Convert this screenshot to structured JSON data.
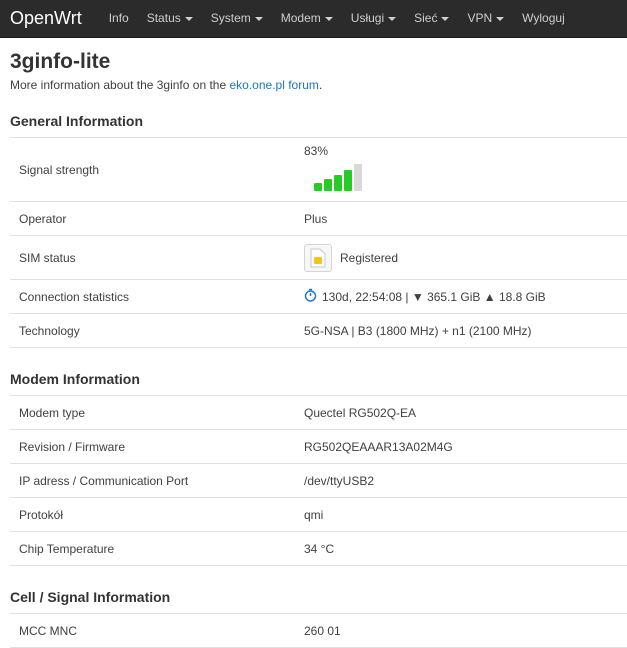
{
  "navbar": {
    "brand": "OpenWrt",
    "items": [
      {
        "label": "Info",
        "dropdown": false
      },
      {
        "label": "Status",
        "dropdown": true
      },
      {
        "label": "System",
        "dropdown": true
      },
      {
        "label": "Modem",
        "dropdown": true
      },
      {
        "label": "Usługi",
        "dropdown": true
      },
      {
        "label": "Sieć",
        "dropdown": true
      },
      {
        "label": "VPN",
        "dropdown": true
      },
      {
        "label": "Wyloguj",
        "dropdown": false
      }
    ]
  },
  "page": {
    "title": "3ginfo-lite",
    "intro_prefix": "More information about the 3ginfo on the ",
    "intro_link": "eko.one.pl forum",
    "intro_suffix": "."
  },
  "general": {
    "heading": "General Information",
    "signal_label": "Signal strength",
    "signal_value": "83%",
    "signal_level": 0.83,
    "signal_color": "#24cc24",
    "operator_label": "Operator",
    "operator_value": "Plus",
    "sim_label": "SIM status",
    "sim_icon": "sim-card-icon",
    "sim_value": "Registered",
    "conn_label": "Connection statistics",
    "conn_icon": "stopwatch-icon",
    "conn_value": "130d, 22:54:08 | ▼ 365.1 GiB ▲ 18.8 GiB",
    "tech_label": "Technology",
    "tech_value": "5G-NSA | B3 (1800 MHz) + n1 (2100 MHz)"
  },
  "modem": {
    "heading": "Modem Information",
    "rows": [
      {
        "label": "Modem type",
        "value": "Quectel RG502Q-EA"
      },
      {
        "label": "Revision / Firmware",
        "value": "RG502QEAAAR13A02M4G"
      },
      {
        "label": "IP adress / Communication Port",
        "value": "/dev/ttyUSB2"
      },
      {
        "label": "Protokół",
        "value": "qmi"
      },
      {
        "label": "Chip Temperature",
        "value": "34 °C"
      }
    ]
  },
  "cell": {
    "heading": "Cell / Signal Information",
    "rows": [
      {
        "label": "MCC MNC",
        "value": "260 01"
      }
    ]
  },
  "colors": {
    "navbar_bg": "#2b2b2b",
    "link": "#1a74c9",
    "signal_green": "#24cc24",
    "sim_chip": "#f5c518"
  }
}
